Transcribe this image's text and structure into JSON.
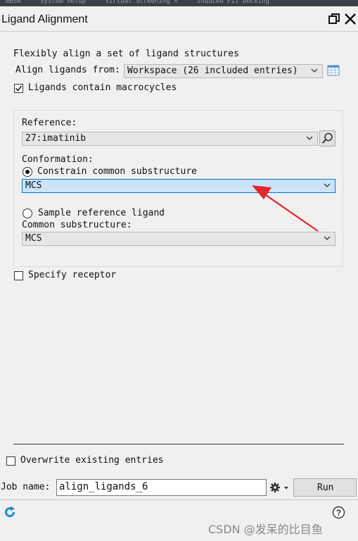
{
  "top_tabs": [
    "eBSA",
    "System Setup",
    "Virtual Screening »",
    "Induced Fit Docking"
  ],
  "window": {
    "title": "Ligand Alignment"
  },
  "intro_text": "Flexibly align a set of ligand structures",
  "align_from": {
    "label": "Align ligands from:",
    "value": "Workspace (26 included entries)"
  },
  "macrocycles": {
    "label": "Ligands contain macrocycles",
    "checked": true
  },
  "reference": {
    "label": "Reference:",
    "value": "27:imatinib"
  },
  "conformation": {
    "label": "Conformation:",
    "constrain_label": "Constrain common substructure",
    "constrain_value": "MCS",
    "sample_label": "Sample reference ligand"
  },
  "common_substructure": {
    "label": "Common substructure:",
    "value": "MCS"
  },
  "specify_receptor": {
    "label": "Specify receptor",
    "checked": false
  },
  "overwrite": {
    "label": "Overwrite existing entries",
    "checked": false
  },
  "job": {
    "label": "Job name:",
    "value": "align_ligands_6"
  },
  "run_label": "Run",
  "watermark": "CSDN @发呆的比目鱼",
  "colors": {
    "highlight": "#cce4f7",
    "highlight_border": "#0078d7",
    "annotation_arrow": "#e3262b"
  }
}
